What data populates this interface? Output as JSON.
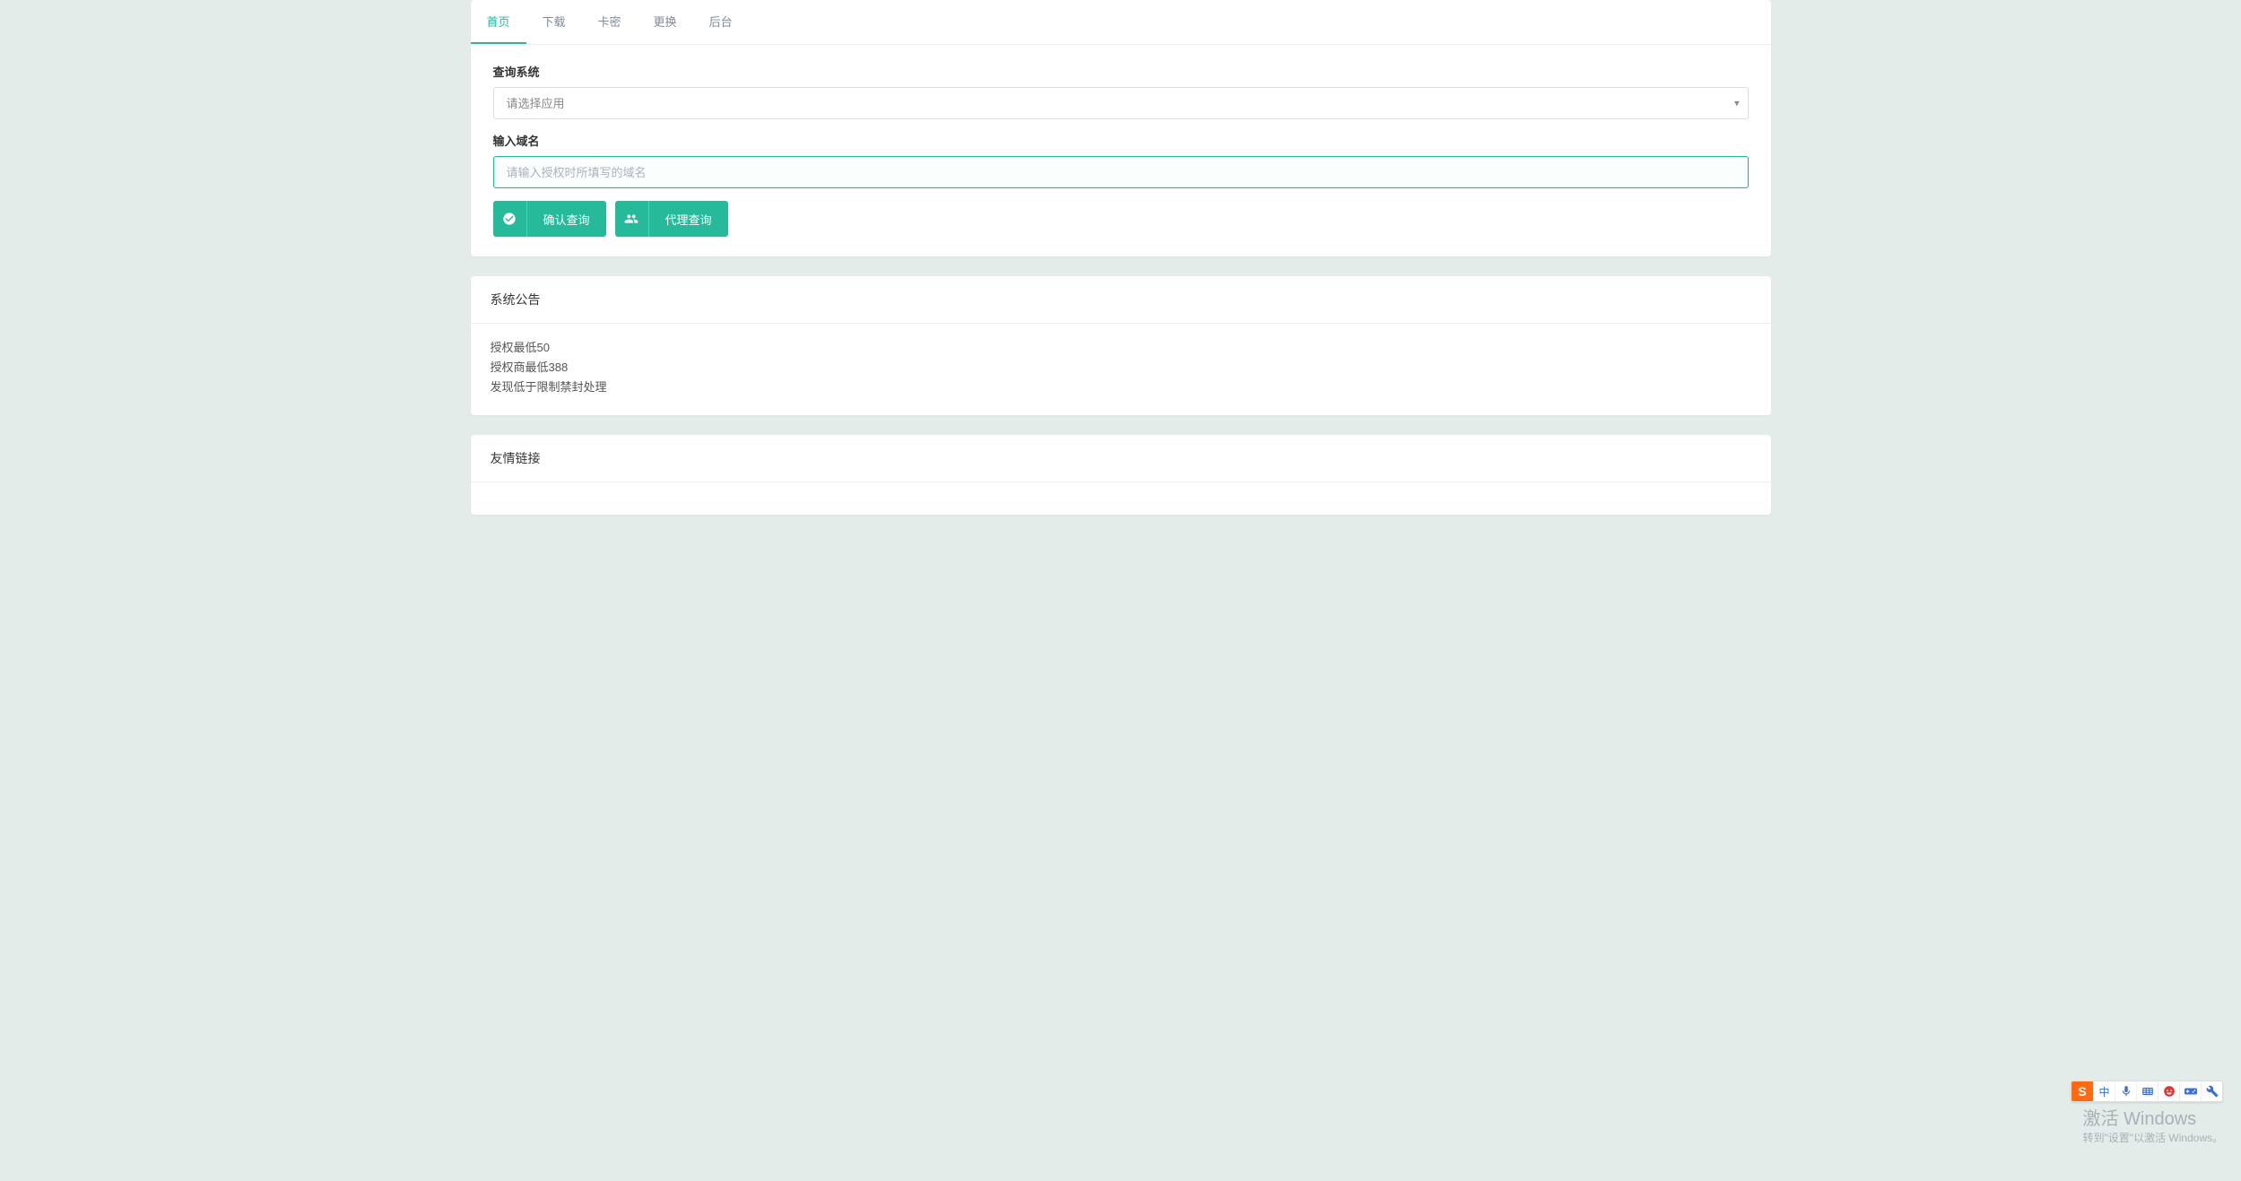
{
  "tabs": {
    "home": "首页",
    "download": "下载",
    "card": "卡密",
    "replace": "更换",
    "backend": "后台"
  },
  "form": {
    "query_system_label": "查询系统",
    "select_placeholder": "请选择应用",
    "domain_label": "输入域名",
    "domain_placeholder": "请输入授权时所填写的域名",
    "confirm_query_label": "确认查询",
    "agent_query_label": "代理查询"
  },
  "announcement": {
    "title": "系统公告",
    "lines": [
      "授权最低50",
      "授权商最低388",
      "发现低于限制禁封处理"
    ]
  },
  "friend_links": {
    "title": "友情链接"
  },
  "watermark": {
    "title": "激活 Windows",
    "sub": "转到\"设置\"以激活 Windows。"
  },
  "ime": {
    "logo": "S",
    "items": [
      "中",
      "mic",
      "key",
      "face",
      "game",
      "tool"
    ]
  }
}
